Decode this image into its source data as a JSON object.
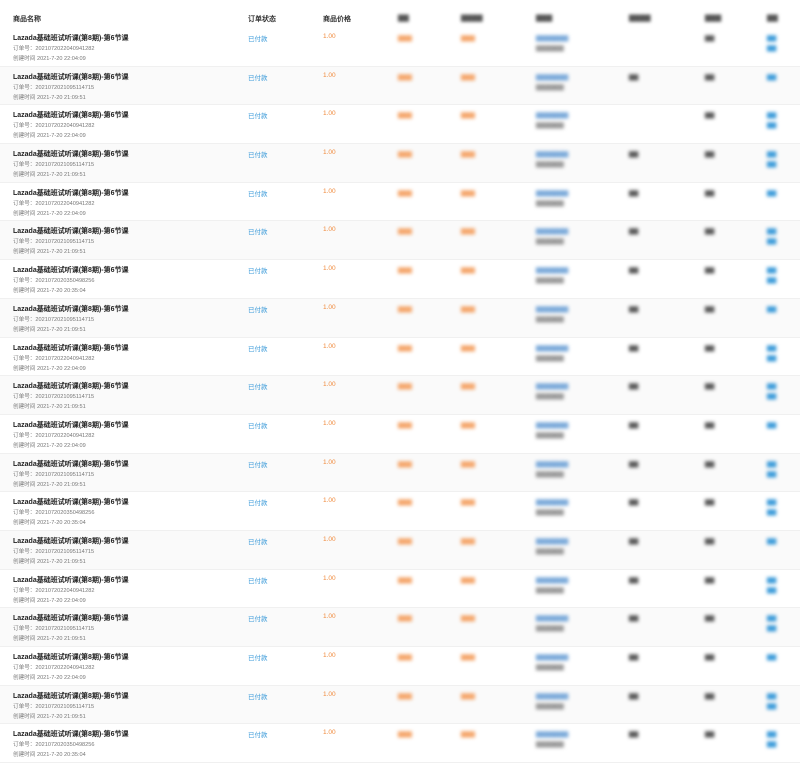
{
  "columns": {
    "product_name": "商品名称",
    "order_status": "订单状态",
    "product_price": "商品价格"
  },
  "labels": {
    "order_no_prefix": "订单号：",
    "created_prefix": "创建时间"
  },
  "orders": [
    {
      "title": "Lazada基础班试听课(第8期)-第6节课",
      "order_no": "202107202204094128​2",
      "created": "2021-7-20 22:04:09",
      "status": "已付款",
      "price": "1.00"
    },
    {
      "title": "Lazada基础班试听课(第8期)-第6节课",
      "order_no": "202107202109511471​5",
      "created": "2021-7-20 21:09:51",
      "status": "已付款",
      "price": "1.00"
    },
    {
      "title": "Lazada基础班试听课(第8期)-第6节课",
      "order_no": "202107202204094128​2",
      "created": "2021-7-20 22:04:09",
      "status": "已付款",
      "price": "1.00"
    },
    {
      "title": "Lazada基础班试听课(第8期)-第6节课",
      "order_no": "202107202109511471​5",
      "created": "2021-7-20 21:09:51",
      "status": "已付款",
      "price": "1.00"
    },
    {
      "title": "Lazada基础班试听课(第8期)-第6节课",
      "order_no": "202107202204094128​2",
      "created": "2021-7-20 22:04:09",
      "status": "已付款",
      "price": "1.00"
    },
    {
      "title": "Lazada基础班试听课(第8期)-第6节课",
      "order_no": "202107202109511471​5",
      "created": "2021-7-20 21:09:51",
      "status": "已付款",
      "price": "1.00"
    },
    {
      "title": "Lazada基础班试听课(第8期)-第6节课",
      "order_no": "202107202035049825​6",
      "created": "2021-7-20 20:35:04",
      "status": "已付款",
      "price": "1.00"
    },
    {
      "title": "Lazada基础班试听课(第8期)-第6节课",
      "order_no": "202107202109511471​5",
      "created": "2021-7-20 21:09:51",
      "status": "已付款",
      "price": "1.00"
    },
    {
      "title": "Lazada基础班试听课(第8期)-第6节课",
      "order_no": "202107202204094128​2",
      "created": "2021-7-20 22:04:09",
      "status": "已付款",
      "price": "1.00"
    },
    {
      "title": "Lazada基础班试听课(第8期)-第6节课",
      "order_no": "202107202109511471​5",
      "created": "2021-7-20 21:09:51",
      "status": "已付款",
      "price": "1.00"
    },
    {
      "title": "Lazada基础班试听课(第8期)-第6节课",
      "order_no": "202107202204094128​2",
      "created": "2021-7-20 22:04:09",
      "status": "已付款",
      "price": "1.00"
    },
    {
      "title": "Lazada基础班试听课(第8期)-第6节课",
      "order_no": "202107202109511471​5",
      "created": "2021-7-20 21:09:51",
      "status": "已付款",
      "price": "1.00"
    },
    {
      "title": "Lazada基础班试听课(第8期)-第6节课",
      "order_no": "202107202035049825​6",
      "created": "2021-7-20 20:35:04",
      "status": "已付款",
      "price": "1.00"
    },
    {
      "title": "Lazada基础班试听课(第8期)-第6节课",
      "order_no": "202107202109511471​5",
      "created": "2021-7-20 21:09:51",
      "status": "已付款",
      "price": "1.00"
    },
    {
      "title": "Lazada基础班试听课(第8期)-第6节课",
      "order_no": "202107202204094128​2",
      "created": "2021-7-20 22:04:09",
      "status": "已付款",
      "price": "1.00"
    },
    {
      "title": "Lazada基础班试听课(第8期)-第6节课",
      "order_no": "202107202109511471​5",
      "created": "2021-7-20 21:09:51",
      "status": "已付款",
      "price": "1.00"
    },
    {
      "title": "Lazada基础班试听课(第8期)-第6节课",
      "order_no": "202107202204094128​2",
      "created": "2021-7-20 22:04:09",
      "status": "已付款",
      "price": "1.00"
    },
    {
      "title": "Lazada基础班试听课(第8期)-第6节课",
      "order_no": "202107202109511471​5",
      "created": "2021-7-20 21:09:51",
      "status": "已付款",
      "price": "1.00"
    },
    {
      "title": "Lazada基础班试听课(第8期)-第6节课",
      "order_no": "202107202035049825​6",
      "created": "2021-7-20 20:35:04",
      "status": "已付款",
      "price": "1.00"
    }
  ]
}
